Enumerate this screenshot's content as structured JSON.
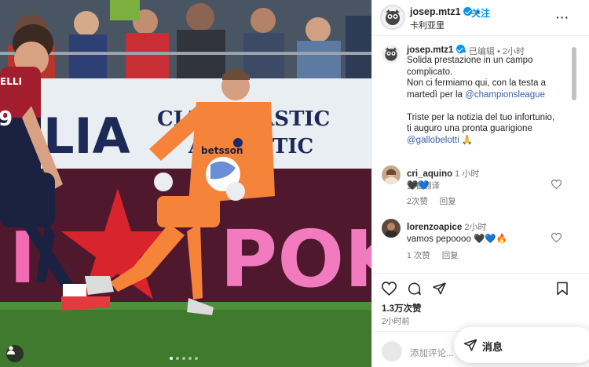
{
  "post": {
    "username": "josep.mtz1",
    "follow_label": "关注",
    "header_separator": "•",
    "location": "卡利亚里",
    "more_label": "···"
  },
  "caption": {
    "username": "josep.mtz1",
    "meta": "• 已编辑 • 2小时",
    "lines": [
      "Solida prestazione in un campo",
      "complicato.",
      "Non ci fermiamo qui, con la testa a",
      "martedì per la"
    ],
    "mention1": "@championsleague",
    "lines2": [
      "Triste per la notizia del tuo infortunio,",
      "ti auguro una pronta guarigione"
    ],
    "mention2": "@gallobelotti",
    "emoji_after_mention2": "🙏",
    "translate": "查看翻译"
  },
  "comments": [
    {
      "username": "cri_aquino",
      "time": "1 小时",
      "text": "🖤💙",
      "likes": "2次赞",
      "reply": "回复"
    },
    {
      "username": "lorenzoapice",
      "time": "2小时",
      "text": "vamos pepoooo 🖤💙🔥",
      "likes": "1 次赞",
      "reply": "回复"
    }
  ],
  "stats": {
    "likes": "1.3万次赞",
    "date": "2小时前"
  },
  "compose": {
    "placeholder": "添加评论..."
  },
  "messages": {
    "label": "消息"
  },
  "photo": {
    "board_text_1": "CIA A PLASTIC",
    "board_text_2": "A ESTETIC",
    "board_big": "LIA",
    "sponsor_left": "I",
    "sponsor_text": "POKE",
    "jersey_number": "9",
    "jersey_name": "ELLI",
    "shirt_sponsor": "betsson",
    "carousel_pages": 5,
    "carousel_current": 1
  }
}
